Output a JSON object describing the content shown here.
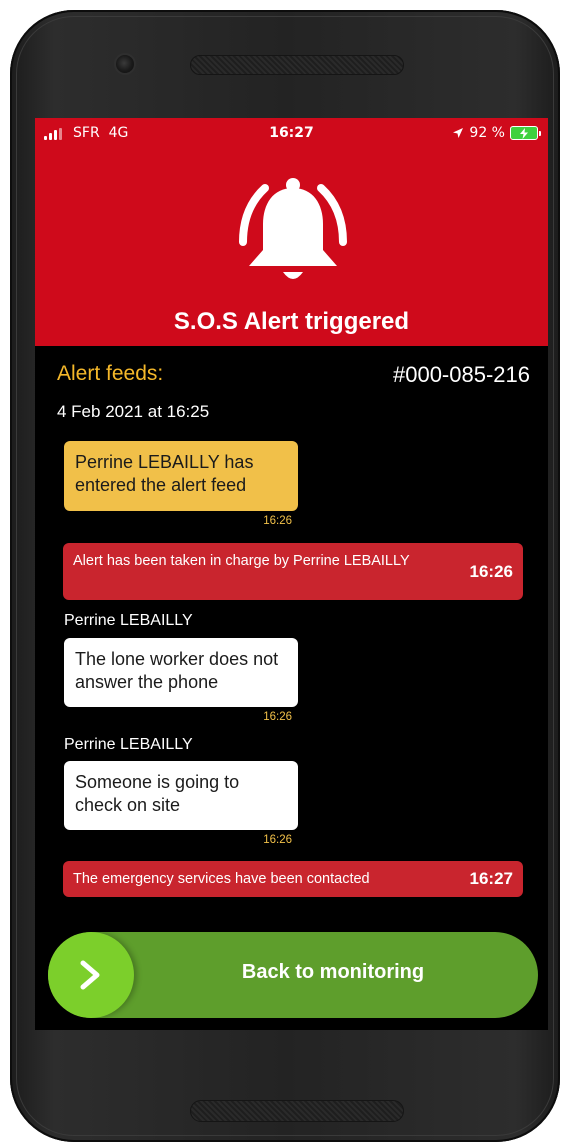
{
  "status_bar": {
    "carrier": "SFR",
    "network": "4G",
    "time": "16:27",
    "battery": "92 %"
  },
  "header": {
    "title": "S.O.S Alert triggered",
    "icon": "bell-ringing-icon",
    "bg_color": "#cf0a1b"
  },
  "feed": {
    "label": "Alert feeds:",
    "alert_id": "#000-085-216",
    "date": "4 Feb 2021 at 16:25"
  },
  "messages": [
    {
      "type": "event",
      "text": "Perrine LEBAILLY has entered the alert feed",
      "time": "16:26"
    },
    {
      "type": "system",
      "text": "Alert has been taken in charge by Perrine LEBAILLY",
      "time": "16:26"
    },
    {
      "type": "message",
      "author": "Perrine LEBAILLY",
      "text": "The lone worker does not answer the phone",
      "time": "16:26"
    },
    {
      "type": "message",
      "author": "Perrine LEBAILLY",
      "text": "Someone is going to check on site",
      "time": "16:26"
    },
    {
      "type": "system",
      "text": "The emergency services have been contacted",
      "time": "16:27"
    }
  ],
  "action": {
    "label": "Back to monitoring",
    "icon": "chevron-right-icon",
    "color": "#5e9e2c",
    "knob_color": "#7ccf2b"
  },
  "colors": {
    "accent_yellow": "#f1c049",
    "system_red": "#c9252e"
  }
}
